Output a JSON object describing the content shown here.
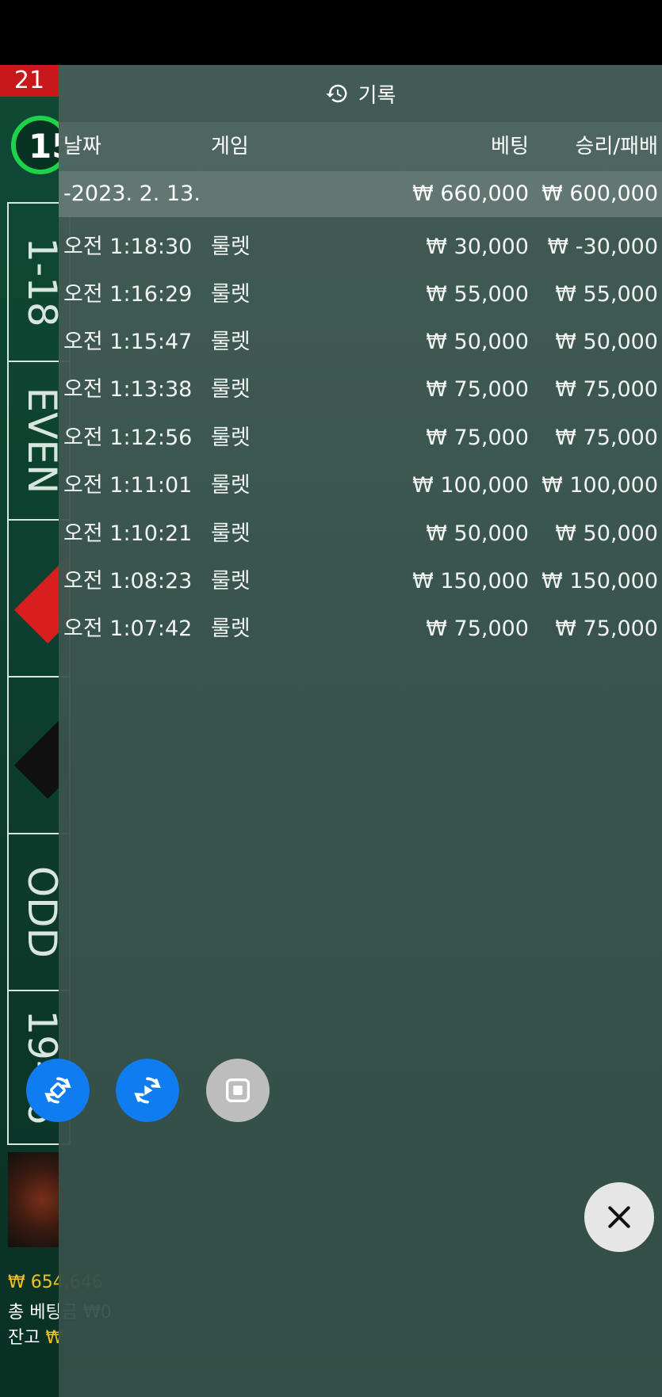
{
  "game": {
    "last_number": "21",
    "timer": "15",
    "outside_bets": [
      "1-18",
      "EVEN",
      "ODD",
      "19-36"
    ],
    "balance_line": "₩ 654,646",
    "total_bet_label": "총 베팅금",
    "total_bet_value": "₩0",
    "remaining_label": "잔고",
    "remaining_value": "₩"
  },
  "history_panel": {
    "title": "기록",
    "columns": {
      "date": "날짜",
      "game": "게임",
      "bet": "베팅",
      "win_loss": "승리/패배"
    },
    "date_group": {
      "date": "-2023. 2. 13.",
      "bet_total": "₩ 660,000",
      "win_total": "₩ 600,000"
    },
    "rows": [
      {
        "time": "오전 1:18:30",
        "game": "룰렛",
        "bet": "₩ 30,000",
        "win": "₩ -30,000"
      },
      {
        "time": "오전 1:16:29",
        "game": "룰렛",
        "bet": "₩ 55,000",
        "win": "₩ 55,000"
      },
      {
        "time": "오전 1:15:47",
        "game": "룰렛",
        "bet": "₩ 50,000",
        "win": "₩ 50,000"
      },
      {
        "time": "오전 1:13:38",
        "game": "룰렛",
        "bet": "₩ 75,000",
        "win": "₩ 75,000"
      },
      {
        "time": "오전 1:12:56",
        "game": "룰렛",
        "bet": "₩ 75,000",
        "win": "₩ 75,000"
      },
      {
        "time": "오전 1:11:01",
        "game": "룰렛",
        "bet": "₩ 100,000",
        "win": "₩ 100,000"
      },
      {
        "time": "오전 1:10:21",
        "game": "룰렛",
        "bet": "₩ 50,000",
        "win": "₩ 50,000"
      },
      {
        "time": "오전 1:08:23",
        "game": "룰렛",
        "bet": "₩ 150,000",
        "win": "₩ 150,000"
      },
      {
        "time": "오전 1:07:42",
        "game": "룰렛",
        "bet": "₩ 75,000",
        "win": "₩ 75,000"
      }
    ]
  },
  "controls": {
    "buttons": [
      "autoplay-icon",
      "replay-icon",
      "stop-icon",
      "close-icon"
    ]
  },
  "colors": {
    "accent_blue": "#0f7cf0",
    "timer_green": "#1ed24a",
    "red": "#c8181b",
    "gold": "#f2c21a"
  }
}
